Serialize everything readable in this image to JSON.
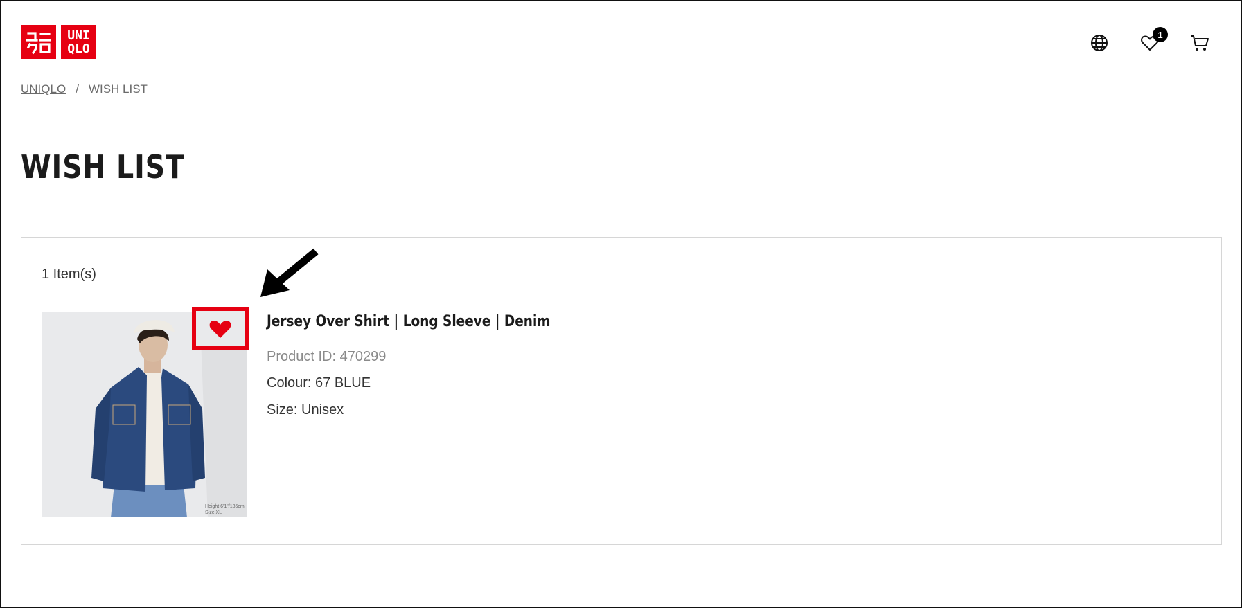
{
  "brand": {
    "logo_text_top": "UNI",
    "logo_text_bottom": "QLO",
    "color": "#e60012"
  },
  "header": {
    "icons": [
      "globe-icon",
      "heart-icon",
      "cart-icon"
    ],
    "wishlist_count": "1"
  },
  "breadcrumb": {
    "home": "UNIQLO",
    "separator": "/",
    "current": "WISH LIST"
  },
  "page": {
    "title": "WISH LIST"
  },
  "wishlist": {
    "item_count": "1 Item(s)",
    "items": [
      {
        "name": "Jersey Over Shirt | Long Sleeve | Denim",
        "product_id": "Product ID: 470299",
        "colour": "Colour: 67 BLUE",
        "size": "Size: Unisex",
        "favorite_icon": "heart-filled-icon",
        "image_caption": [
          "Height 6'1\"/185cm",
          "Size XL"
        ]
      }
    ]
  },
  "annotation": {
    "highlight_color": "#e60012",
    "arrow_color": "#000000"
  }
}
